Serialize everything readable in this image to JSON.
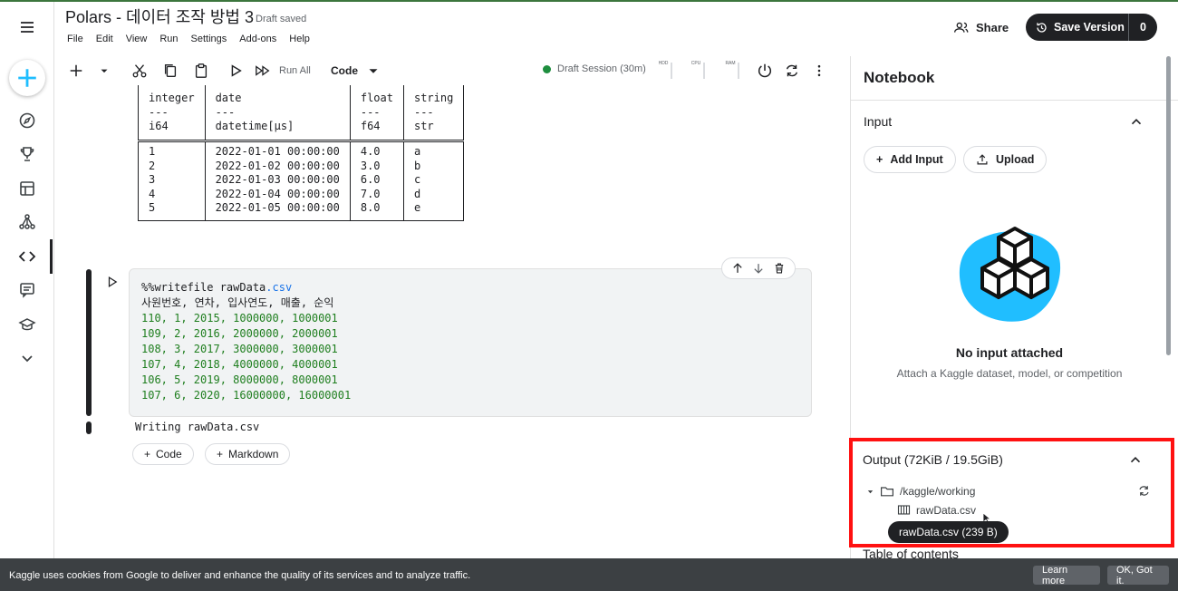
{
  "header": {
    "title": "Polars - 데이터 조작 방법 3",
    "draft_status": "Draft saved",
    "menu": [
      "File",
      "Edit",
      "View",
      "Run",
      "Settings",
      "Add-ons",
      "Help"
    ],
    "share_label": "Share",
    "save_version_label": "Save Version",
    "save_version_count": "0"
  },
  "toolbar": {
    "run_all_label": "Run All",
    "cell_type": "Code",
    "session_label": "Draft Session (30m)",
    "meters": [
      "HDD",
      "CPU",
      "RAM"
    ]
  },
  "dataframe": {
    "columns": [
      {
        "name": "integer",
        "sep": "---",
        "dtype": "i64"
      },
      {
        "name": "date",
        "sep": "---",
        "dtype": "datetime[μs]"
      },
      {
        "name": "float",
        "sep": "---",
        "dtype": "f64"
      },
      {
        "name": "string",
        "sep": "---",
        "dtype": "str"
      }
    ],
    "rows": [
      [
        "1",
        "2022-01-01 00:00:00",
        "4.0",
        "a"
      ],
      [
        "2",
        "2022-01-02 00:00:00",
        "3.0",
        "b"
      ],
      [
        "3",
        "2022-01-03 00:00:00",
        "6.0",
        "c"
      ],
      [
        "4",
        "2022-01-04 00:00:00",
        "7.0",
        "d"
      ],
      [
        "5",
        "2022-01-05 00:00:00",
        "8.0",
        "e"
      ]
    ]
  },
  "code_cell": {
    "magic": "%%writefile rawData",
    "ext": ".csv",
    "header_line": "사원번호, 연차, 입사연도, 매출, 순익",
    "data_lines": [
      "110, 1, 2015, 1000000, 1000001",
      "109, 2, 2016, 2000000, 2000001",
      "108, 3, 2017, 3000000, 3000001",
      "107, 4, 2018, 4000000, 4000001",
      "106, 5, 2019, 8000000, 8000001",
      "107, 6, 2020, 16000000, 16000001"
    ],
    "output": "Writing rawData.csv"
  },
  "add_cell": {
    "code_label": "Code",
    "markdown_label": "Markdown"
  },
  "panel": {
    "title": "Notebook",
    "input_title": "Input",
    "add_input_label": "Add Input",
    "upload_label": "Upload",
    "empty_title": "No input attached",
    "empty_subtitle": "Attach a Kaggle dataset, model, or competition",
    "output_title": "Output (72KiB / 19.5GiB)",
    "output_folder": "/kaggle/working",
    "output_file": "rawData.csv",
    "tooltip": "rawData.csv (239 B)",
    "toc_title": "Table of contents"
  },
  "cookie": {
    "text": "Kaggle uses cookies from Google to deliver and enhance the quality of its services and to analyze traffic.",
    "learn_more": "Learn more",
    "ok": "OK, Got it."
  },
  "colors": {
    "accent": "#1a73e8",
    "dark": "#202124",
    "session_green": "#1e8e3e",
    "highlight_red": "#ff1111",
    "cube_blue": "#20beff"
  }
}
